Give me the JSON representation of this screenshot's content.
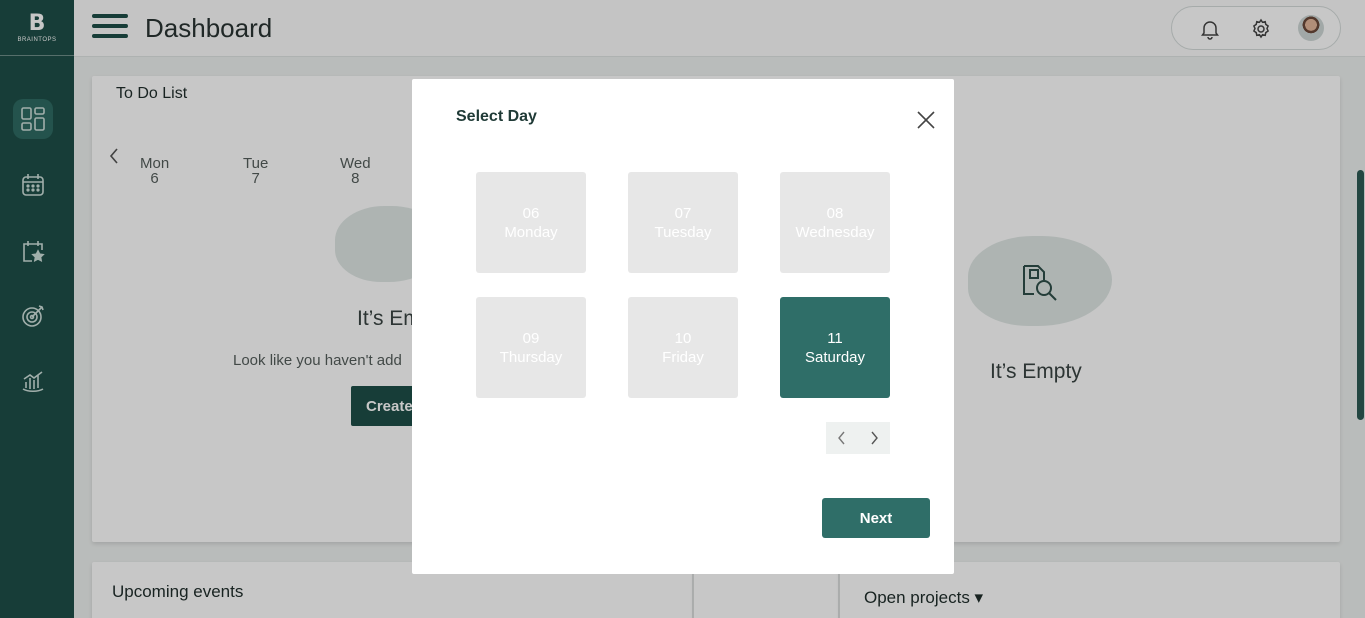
{
  "app": {
    "logo_mark": "B",
    "logo_text": "BRAINTOPS"
  },
  "header": {
    "title": "Dashboard"
  },
  "todo": {
    "title": "To Do List",
    "days": [
      {
        "name": "Mon",
        "num": "6"
      },
      {
        "name": "Tue",
        "num": "7"
      },
      {
        "name": "Wed",
        "num": "8"
      }
    ],
    "empty_text": "It’s Em",
    "sub_text": "Look like you haven't add",
    "create_label": "Create"
  },
  "right_panel": {
    "empty_text": "It’s Empty"
  },
  "events": {
    "title": "Upcoming events"
  },
  "projects": {
    "title": "Open projects ▾"
  },
  "modal": {
    "title": "Select Day",
    "next_label": "Next",
    "days": [
      {
        "num": "06",
        "name": "Monday",
        "selected": false
      },
      {
        "num": "07",
        "name": "Tuesday",
        "selected": false
      },
      {
        "num": "08",
        "name": "Wednesday",
        "selected": false
      },
      {
        "num": "09",
        "name": "Thursday",
        "selected": false
      },
      {
        "num": "10",
        "name": "Friday",
        "selected": false
      },
      {
        "num": "11",
        "name": "Saturday",
        "selected": true
      }
    ]
  },
  "colors": {
    "primary": "#1e4f48",
    "accent": "#2f6e68",
    "tile_disabled": "#e7e7e7"
  },
  "icons": [
    "dashboard-icon",
    "calendar-icon",
    "calendar-star-icon",
    "target-icon",
    "chart-icon",
    "bell-icon",
    "gear-icon",
    "close-icon",
    "chevron-left-icon",
    "chevron-right-icon"
  ]
}
